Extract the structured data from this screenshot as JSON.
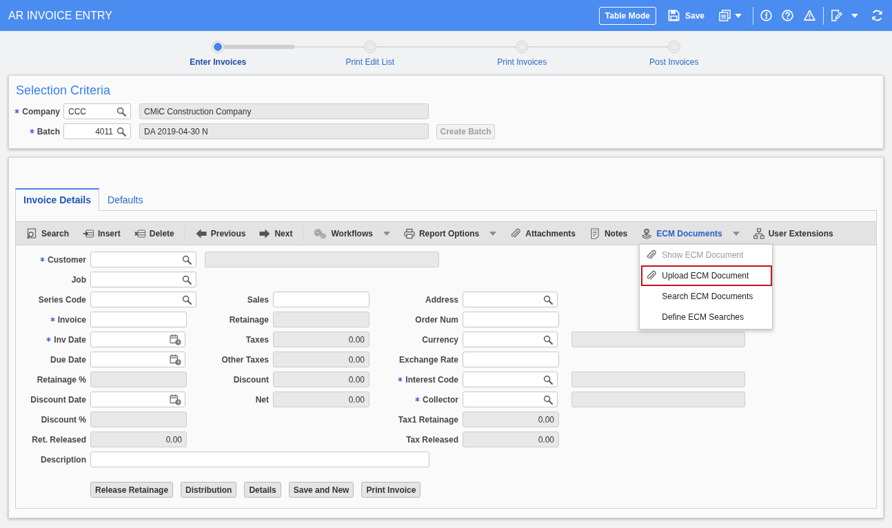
{
  "header": {
    "title": "AR INVOICE ENTRY",
    "table_mode_button": "Table Mode",
    "save_button": "Save"
  },
  "stepper": {
    "steps": [
      {
        "label": "Enter Invoices",
        "selected": true,
        "level": 0.5
      },
      {
        "label": "Print Edit List",
        "selected": false
      },
      {
        "label": "Print Invoices",
        "selected": false
      },
      {
        "label": "Post Invoices",
        "selected": false
      }
    ]
  },
  "selection_criteria": {
    "title": "Selection Criteria",
    "fields": [
      {
        "label": "Company",
        "required": true,
        "value": "CCC",
        "numeric": false,
        "description": "CMiC Construction Company"
      },
      {
        "label": "Batch",
        "required": true,
        "value": "4011",
        "numeric": true,
        "description": "DA 2019-04-30 N",
        "action": {
          "label": "Create Batch",
          "disabled": true
        }
      }
    ]
  },
  "tabs": [
    {
      "label": "Invoice Details",
      "selected": true
    },
    {
      "label": "Defaults",
      "selected": false
    }
  ],
  "toolbar": {
    "groups": [
      {
        "items": [
          {
            "label": "Search",
            "dropdown": false,
            "expanded": false
          },
          {
            "label": "Insert",
            "dropdown": false,
            "expanded": false
          },
          {
            "label": "Delete",
            "dropdown": false,
            "expanded": false
          }
        ]
      },
      {
        "items": [
          {
            "label": "Previous",
            "dropdown": false,
            "expanded": false
          },
          {
            "label": "Next",
            "dropdown": false,
            "expanded": false
          }
        ]
      },
      {
        "items": [
          {
            "label": "Workflows",
            "dropdown": true,
            "expanded": false
          },
          {
            "label": "Report Options",
            "dropdown": true,
            "expanded": false
          },
          {
            "label": "Attachments",
            "dropdown": false,
            "expanded": false
          },
          {
            "label": "Notes",
            "dropdown": false,
            "expanded": false
          },
          {
            "label": "ECM Documents",
            "dropdown": true,
            "expanded": true,
            "menu": [
              {
                "label": "Show ECM Document",
                "disabled": true,
                "highlighted": false
              },
              {
                "label": "Upload ECM Document",
                "disabled": false,
                "highlighted": true
              },
              {
                "label": "Search ECM Documents",
                "disabled": false,
                "highlighted": false
              },
              {
                "label": "Define ECM Searches",
                "disabled": false,
                "highlighted": false
              }
            ]
          },
          {
            "label": "User Extensions",
            "dropdown": false,
            "expanded": false
          }
        ]
      }
    ]
  },
  "form": {
    "rows": [
      {
        "left": {
          "label": "Customer",
          "required": true,
          "kind": "lookup",
          "display_field": true
        }
      },
      {
        "left": {
          "label": "Job",
          "required": false,
          "kind": "lookup",
          "display_field": false
        }
      },
      {
        "left": {
          "label": "Series Code",
          "required": false,
          "kind": "lookup",
          "display_field": false
        },
        "middle": {
          "label": "Sales",
          "required": false,
          "kind": "text",
          "display_field": false
        },
        "right": {
          "label": "Address",
          "required": false,
          "kind": "lookup",
          "display_field": false
        }
      },
      {
        "left": {
          "label": "Invoice",
          "required": true,
          "kind": "text",
          "display_field": false
        },
        "middle": {
          "label": "Retainage",
          "required": false,
          "kind": "readonly",
          "display_field": false
        },
        "right": {
          "label": "Order Num",
          "required": false,
          "kind": "text",
          "display_field": false
        }
      },
      {
        "left": {
          "label": "Inv Date",
          "required": true,
          "kind": "date",
          "display_field": false
        },
        "middle": {
          "label": "Taxes",
          "required": false,
          "kind": "readonly",
          "value": "0.00",
          "display_field": false
        },
        "right": {
          "label": "Currency",
          "required": false,
          "kind": "lookup",
          "display_field": true
        }
      },
      {
        "left": {
          "label": "Due Date",
          "required": false,
          "kind": "date",
          "display_field": false
        },
        "middle": {
          "label": "Other Taxes",
          "required": false,
          "kind": "readonly",
          "value": "0.00",
          "display_field": false
        },
        "right": {
          "label": "Exchange Rate",
          "required": false,
          "kind": "text",
          "display_field": false
        }
      },
      {
        "left": {
          "label": "Retainage %",
          "required": false,
          "kind": "readonly",
          "display_field": false
        },
        "middle": {
          "label": "Discount",
          "required": false,
          "kind": "readonly",
          "value": "0.00",
          "display_field": false
        },
        "right": {
          "label": "Interest Code",
          "required": true,
          "kind": "lookup",
          "display_field": true
        }
      },
      {
        "left": {
          "label": "Discount Date",
          "required": false,
          "kind": "date",
          "display_field": false
        },
        "middle": {
          "label": "Net",
          "required": false,
          "kind": "readonly",
          "value": "0.00",
          "display_field": false
        },
        "right": {
          "label": "Collector",
          "required": true,
          "kind": "lookup",
          "display_field": true
        }
      },
      {
        "left": {
          "label": "Discount %",
          "required": false,
          "kind": "readonly",
          "display_field": false
        },
        "right": {
          "label": "Tax1 Retainage",
          "required": false,
          "kind": "readonly",
          "value": "0.00",
          "display_field": false
        }
      },
      {
        "left": {
          "label": "Ret. Released",
          "required": false,
          "kind": "readonly",
          "value": "0.00",
          "display_field": false
        },
        "right": {
          "label": "Tax Released",
          "required": false,
          "kind": "readonly",
          "value": "0.00",
          "display_field": false
        }
      },
      {
        "left": {
          "label": "Description",
          "required": false,
          "kind": "memo",
          "display_field": false
        }
      }
    ]
  },
  "buttons": [
    "Release Retainage",
    "Distribution",
    "Details",
    "Save and New",
    "Print Invoice"
  ]
}
